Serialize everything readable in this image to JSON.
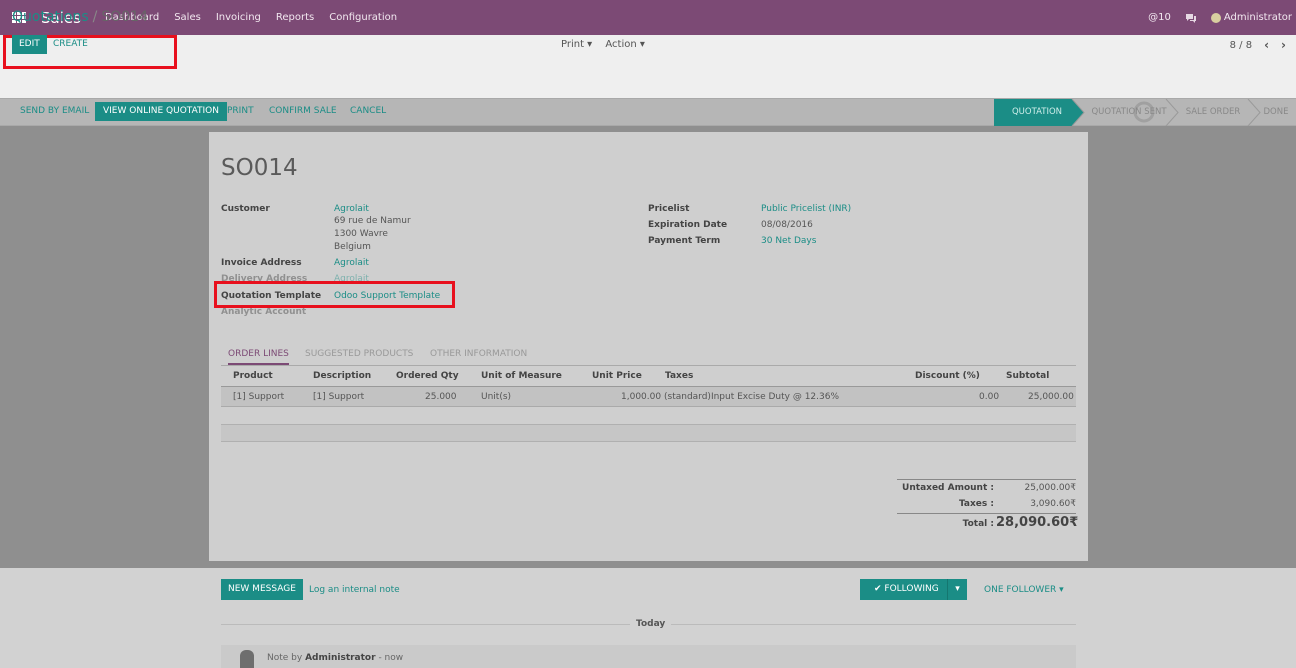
{
  "navbar": {
    "app_name": "Sales",
    "menu": [
      "Dashboard",
      "Sales",
      "Invoicing",
      "Reports",
      "Configuration"
    ],
    "messages_count": "@10",
    "user": "Administrator"
  },
  "breadcrumb": {
    "parent": "Quotations",
    "separator": "/",
    "current": "SO014"
  },
  "control": {
    "edit_label": "EDIT",
    "create_label": "CREATE",
    "print_label": "Print ▾",
    "action_label": "Action ▾",
    "pager": "8 / 8",
    "prev": "‹",
    "next": "›"
  },
  "statusbar": {
    "buttons": [
      "SEND BY EMAIL",
      "VIEW ONLINE QUOTATION",
      "PRINT",
      "CONFIRM SALE",
      "CANCEL"
    ],
    "stages": [
      "QUOTATION",
      "QUOTATION SENT",
      "SALE ORDER",
      "DONE"
    ],
    "active_stage": "QUOTATION"
  },
  "form": {
    "title": "SO014",
    "customer_label": "Customer",
    "customer_name": "Agrolait",
    "customer_address": [
      "69 rue de Namur",
      "1300 Wavre",
      "Belgium"
    ],
    "invoice_address_label": "Invoice Address",
    "invoice_address": "Agrolait",
    "delivery_address_label": "Delivery Address",
    "delivery_address": "Agrolait",
    "template_label": "Quotation Template",
    "template_value": "Odoo Support Template",
    "analytic_label": "Analytic Account",
    "pricelist_label": "Pricelist",
    "pricelist": "Public Pricelist (INR)",
    "expiration_label": "Expiration Date",
    "expiration": "08/08/2016",
    "payment_term_label": "Payment Term",
    "payment_term": "30 Net Days"
  },
  "tabs": [
    "ORDER LINES",
    "SUGGESTED PRODUCTS",
    "OTHER INFORMATION"
  ],
  "table": {
    "columns": [
      "Product",
      "Description",
      "Ordered Qty",
      "Unit of Measure",
      "Unit Price",
      "Taxes",
      "Discount (%)",
      "Subtotal"
    ],
    "rows": [
      [
        "[1] Support",
        "[1] Support",
        "25.000",
        "Unit(s)",
        "1,000.00",
        "(standard)Input Excise Duty @ 12.36%",
        "0.00",
        "25,000.00"
      ]
    ]
  },
  "totals": {
    "untaxed_label": "Untaxed Amount :",
    "untaxed": "25,000.00₹",
    "taxes_label": "Taxes :",
    "taxes": "3,090.60₹",
    "total_label": "Total :",
    "total": "28,090.60₹"
  },
  "chatter": {
    "new_message": "NEW MESSAGE",
    "log_note": "Log an internal note",
    "following": "✔ FOLLOWING",
    "follower_caret": "▾",
    "one_follower": "ONE FOLLOWER ▾",
    "today": "Today",
    "note_prefix": "Note by",
    "note_author": "Administrator",
    "note_time": "- now"
  },
  "colors": {
    "brand": "#7c4a75",
    "accent": "#1b8d86",
    "highlight": "#e8101d"
  }
}
